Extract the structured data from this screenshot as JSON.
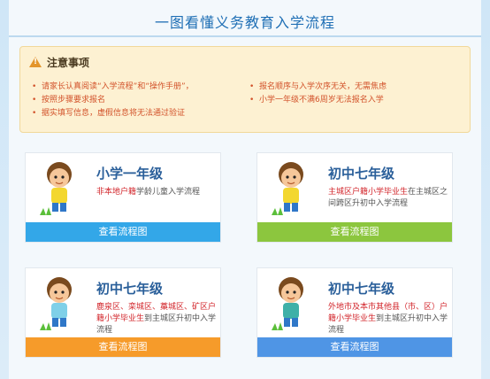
{
  "title": "一图看懂义务教育入学流程",
  "notice": {
    "title": "注意事项",
    "left": [
      "请家长认真阅读“入学流程”和“操作手册”，",
      "按照步骤要求报名",
      "据实填写信息，虚假信息将无法通过验证"
    ],
    "right": [
      "报名顺序与入学次序无关，无需焦虑",
      "小学一年级不满6周岁无法报名入学"
    ]
  },
  "cards": [
    {
      "heading": "小学一年级",
      "desc_hl": "非本地户籍",
      "desc_rest": "学龄儿童入学流程",
      "button": "查看流程图",
      "color": "#33a7e8"
    },
    {
      "heading": "初中七年级",
      "desc_hl": "主城区户籍小学毕业生",
      "desc_rest": "在主城区之间跨区升初中入学流程",
      "button": "查看流程图",
      "color": "#8cc63e"
    },
    {
      "heading": "初中七年级",
      "desc_hl": "鹿泉区、栾城区、藁城区、矿区户籍小学毕业生",
      "desc_rest": "到主城区升初中入学流程",
      "button": "查看流程图",
      "color": "#f69b2a"
    },
    {
      "heading": "初中七年级",
      "desc_hl": "外地市及本市其他县（市、区）户籍小学毕业生",
      "desc_rest": "到主城区升初中入学流程",
      "button": "查看流程图",
      "color": "#4f95e5"
    }
  ],
  "icons": {
    "warning": "warning-triangle-icon",
    "kid": "cartoon-child-icon"
  }
}
